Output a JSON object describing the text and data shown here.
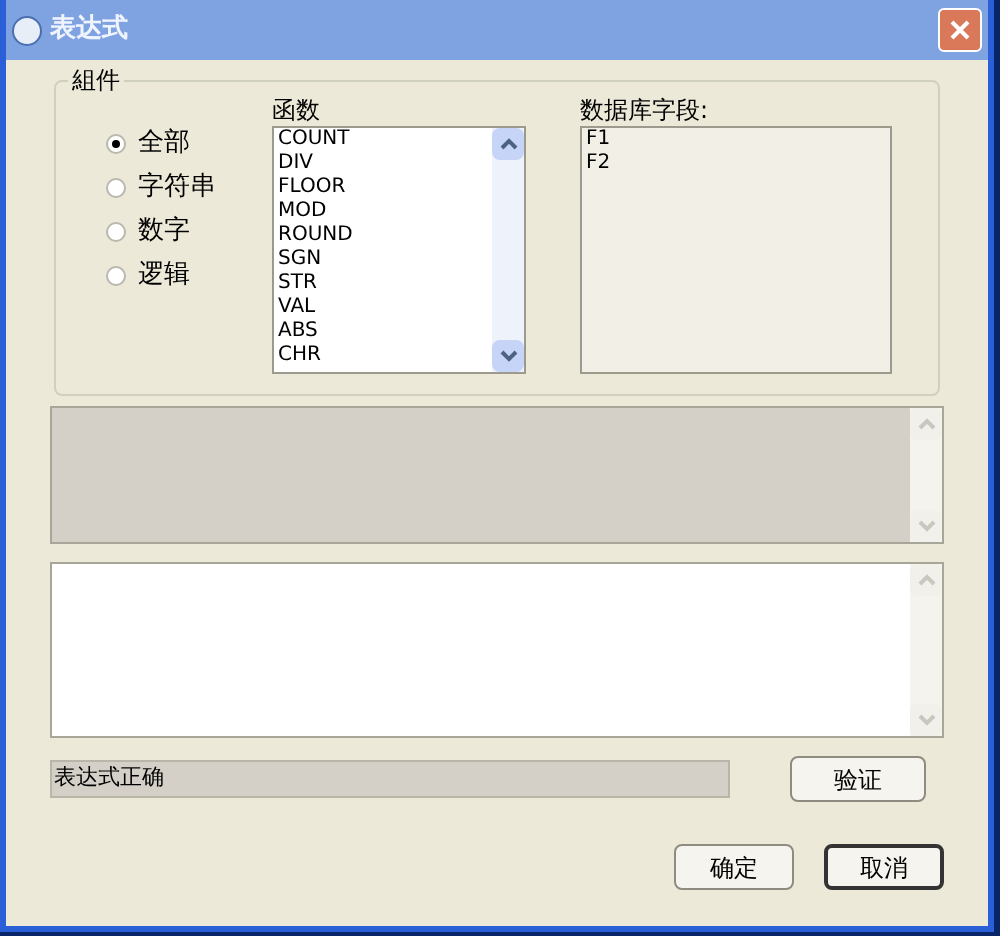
{
  "window": {
    "title": "表达式"
  },
  "group": {
    "title": "組件"
  },
  "radios": [
    {
      "label": "全部",
      "selected": true
    },
    {
      "label": "字符串",
      "selected": false
    },
    {
      "label": "数字",
      "selected": false
    },
    {
      "label": "逻辑",
      "selected": false
    }
  ],
  "functions": {
    "label": "函数",
    "items": [
      "COUNT",
      "DIV",
      "FLOOR",
      "MOD",
      "ROUND",
      "SGN",
      "STR",
      "VAL",
      "ABS",
      "CHR"
    ]
  },
  "fields": {
    "label": "数据库字段:",
    "items": [
      "F1",
      "F2"
    ]
  },
  "status": {
    "value": "表达式正确"
  },
  "buttons": {
    "verify": "验证",
    "ok": "确定",
    "cancel": "取消"
  }
}
